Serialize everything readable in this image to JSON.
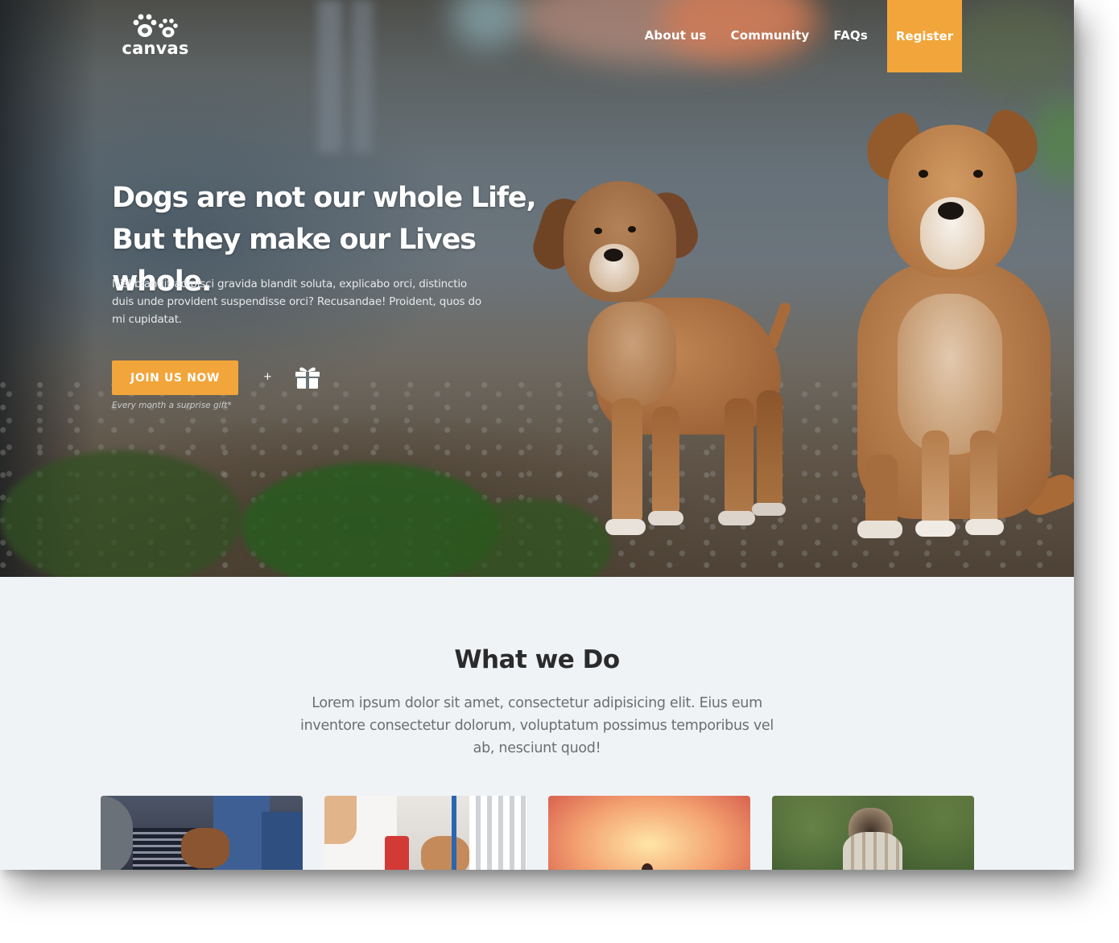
{
  "brand": {
    "name": "canvas",
    "logo_icon": "paw-prints-icon"
  },
  "nav": {
    "items": [
      {
        "label": "About us"
      },
      {
        "label": "Community"
      },
      {
        "label": "FAQs"
      }
    ],
    "register_label": "Register"
  },
  "hero": {
    "title_line1": "Dogs are not our whole Life,",
    "title_line2": "But they make our Lives whole.",
    "text": "Nisl blandit adipisci gravida blandit soluta, explicabo orci, distinctio duis unde provident suspendisse orci? Recusandae! Proident, quos do mi cupidatat.",
    "cta_label": "JOIN US NOW",
    "plus": "+",
    "gift_icon": "gift-icon",
    "gift_note": "Every month a surprise gift*"
  },
  "what_we_do": {
    "title": "What we Do",
    "text": "Lorem ipsum dolor sit amet, consectetur adipisicing elit. Eius eum inventore consectetur dolorum, voluptatum possimus temporibus vel ab, nesciunt quod!"
  },
  "colors": {
    "accent": "#f2a53a",
    "section_background": "#f0f3f6",
    "heading": "#2b2b2b",
    "body_text": "#6b6f72"
  }
}
